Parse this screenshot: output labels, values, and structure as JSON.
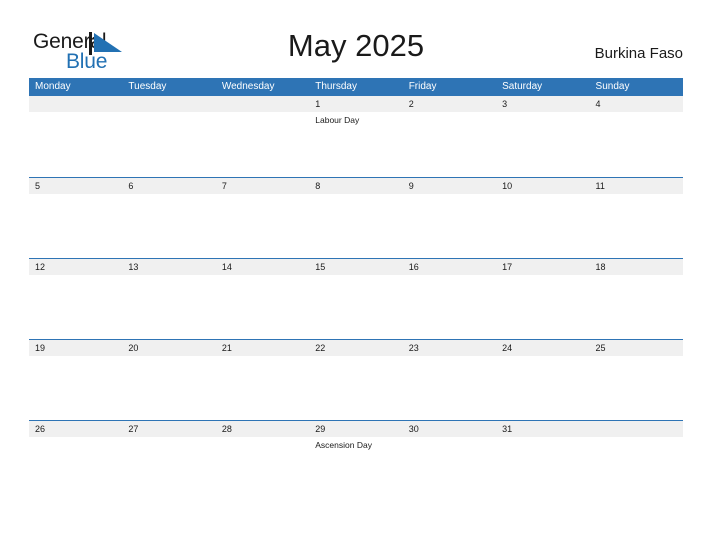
{
  "brand": {
    "name_part1": "General",
    "name_part2": "Blue",
    "mark_icon": "triangle-logo-icon",
    "accent_color": "#2271b3"
  },
  "header": {
    "title": "May 2025",
    "region": "Burkina Faso"
  },
  "calendar": {
    "header_color": "#2e74b5",
    "date_strip_color": "#f0f0f0",
    "weekdays": [
      "Monday",
      "Tuesday",
      "Wednesday",
      "Thursday",
      "Friday",
      "Saturday",
      "Sunday"
    ],
    "weeks": [
      {
        "days": [
          {
            "date": "",
            "event": ""
          },
          {
            "date": "",
            "event": ""
          },
          {
            "date": "",
            "event": ""
          },
          {
            "date": "1",
            "event": "Labour Day"
          },
          {
            "date": "2",
            "event": ""
          },
          {
            "date": "3",
            "event": ""
          },
          {
            "date": "4",
            "event": ""
          }
        ]
      },
      {
        "days": [
          {
            "date": "5",
            "event": ""
          },
          {
            "date": "6",
            "event": ""
          },
          {
            "date": "7",
            "event": ""
          },
          {
            "date": "8",
            "event": ""
          },
          {
            "date": "9",
            "event": ""
          },
          {
            "date": "10",
            "event": ""
          },
          {
            "date": "11",
            "event": ""
          }
        ]
      },
      {
        "days": [
          {
            "date": "12",
            "event": ""
          },
          {
            "date": "13",
            "event": ""
          },
          {
            "date": "14",
            "event": ""
          },
          {
            "date": "15",
            "event": ""
          },
          {
            "date": "16",
            "event": ""
          },
          {
            "date": "17",
            "event": ""
          },
          {
            "date": "18",
            "event": ""
          }
        ]
      },
      {
        "days": [
          {
            "date": "19",
            "event": ""
          },
          {
            "date": "20",
            "event": ""
          },
          {
            "date": "21",
            "event": ""
          },
          {
            "date": "22",
            "event": ""
          },
          {
            "date": "23",
            "event": ""
          },
          {
            "date": "24",
            "event": ""
          },
          {
            "date": "25",
            "event": ""
          }
        ]
      },
      {
        "days": [
          {
            "date": "26",
            "event": ""
          },
          {
            "date": "27",
            "event": ""
          },
          {
            "date": "28",
            "event": ""
          },
          {
            "date": "29",
            "event": "Ascension Day"
          },
          {
            "date": "30",
            "event": ""
          },
          {
            "date": "31",
            "event": ""
          },
          {
            "date": "",
            "event": ""
          }
        ]
      }
    ]
  }
}
